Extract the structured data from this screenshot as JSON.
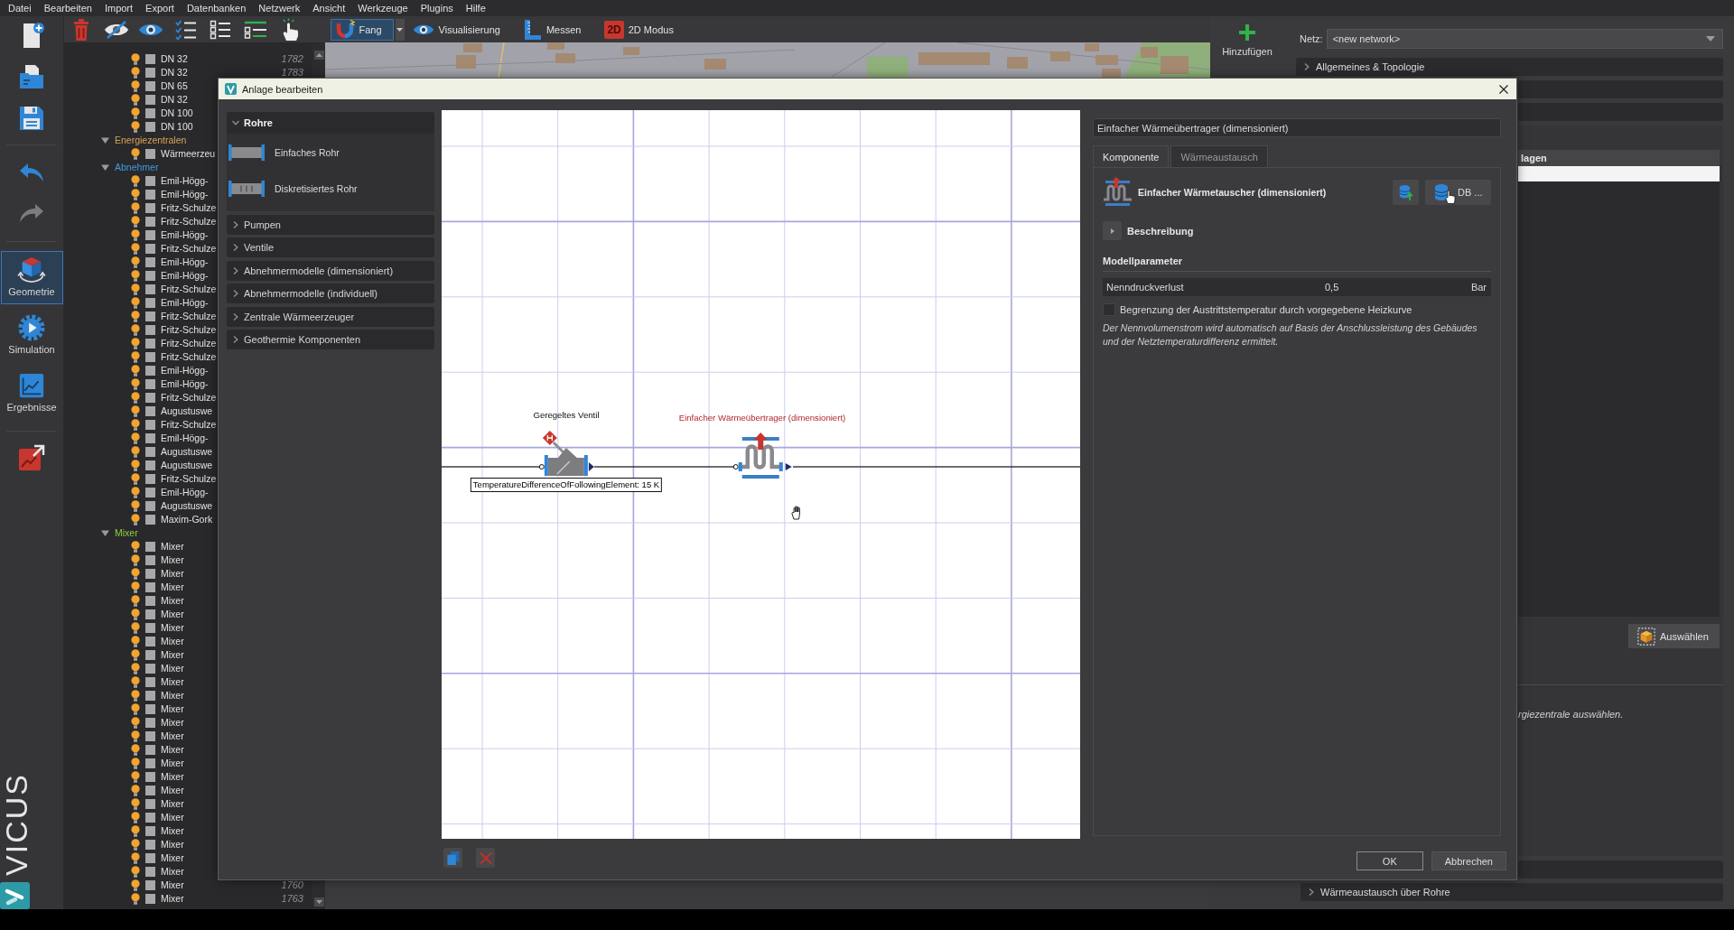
{
  "menu_bar": {
    "items": [
      "Datei",
      "Bearbeiten",
      "Import",
      "Export",
      "Datenbanken",
      "Netzwerk",
      "Ansicht",
      "Werkzeuge",
      "Plugins",
      "Hilfe"
    ]
  },
  "toolbar": {
    "mode_buttons": [
      {
        "kind": "snap",
        "label": "Fang",
        "selected": true,
        "dropdown": true
      },
      {
        "kind": "visualize",
        "label": "Visualisierung",
        "selected": false,
        "dropdown": false
      },
      {
        "kind": "measure",
        "label": "Messen",
        "selected": false,
        "dropdown": false
      },
      {
        "kind": "view2d",
        "badge": "2D",
        "label": "2D Modus",
        "selected": false,
        "dropdown": false
      }
    ]
  },
  "sidebar": {
    "file_actions": [
      {
        "kind": "new",
        "disabled": false
      },
      {
        "kind": "open",
        "disabled": false
      },
      {
        "kind": "save",
        "disabled": false
      }
    ],
    "history_actions": [
      {
        "kind": "undo",
        "disabled": false
      },
      {
        "kind": "redo",
        "disabled": true
      }
    ],
    "nav": [
      {
        "kind": "geometry",
        "label": "Geometrie",
        "selected": true
      },
      {
        "kind": "simulation",
        "label": "Simulation",
        "selected": false
      },
      {
        "kind": "results",
        "label": "Ergebnisse",
        "selected": false
      }
    ],
    "logo_text": "VICUS"
  },
  "tree": {
    "continued_items": [
      {
        "label": "DN 32",
        "number": "1782"
      },
      {
        "label": "DN 32",
        "number": "1783"
      },
      {
        "label": "DN 65"
      },
      {
        "label": "DN 32"
      },
      {
        "label": "DN 100"
      },
      {
        "label": "DN 100"
      }
    ],
    "groups": [
      {
        "label": "Energiezentralen",
        "color": "#d9a25a",
        "expanded": true,
        "children": [
          {
            "label": "Wärmeerzeu"
          }
        ]
      },
      {
        "label": "Abnehmer",
        "color": "#3d9be0",
        "expanded": true,
        "children": [
          {
            "label": "Emil-Högg-"
          },
          {
            "label": "Emil-Högg-"
          },
          {
            "label": "Fritz-Schulze"
          },
          {
            "label": "Fritz-Schulze"
          },
          {
            "label": "Emil-Högg-"
          },
          {
            "label": "Fritz-Schulze"
          },
          {
            "label": "Emil-Högg-"
          },
          {
            "label": "Emil-Högg-"
          },
          {
            "label": "Fritz-Schulze"
          },
          {
            "label": "Emil-Högg-"
          },
          {
            "label": "Fritz-Schulze"
          },
          {
            "label": "Fritz-Schulze"
          },
          {
            "label": "Fritz-Schulze"
          },
          {
            "label": "Fritz-Schulze"
          },
          {
            "label": "Emil-Högg-"
          },
          {
            "label": "Emil-Högg-"
          },
          {
            "label": "Fritz-Schulze"
          },
          {
            "label": "Augustuswe"
          },
          {
            "label": "Fritz-Schulze"
          },
          {
            "label": "Emil-Högg-"
          },
          {
            "label": "Augustuswe"
          },
          {
            "label": "Augustuswe"
          },
          {
            "label": "Fritz-Schulze"
          },
          {
            "label": "Emil-Högg-"
          },
          {
            "label": "Augustuswe"
          },
          {
            "label": "Maxim-Gork"
          }
        ]
      },
      {
        "label": "Mixer",
        "color": "#8fd13a",
        "expanded": true,
        "children": [
          {
            "label": "Mixer"
          },
          {
            "label": "Mixer"
          },
          {
            "label": "Mixer"
          },
          {
            "label": "Mixer"
          },
          {
            "label": "Mixer"
          },
          {
            "label": "Mixer"
          },
          {
            "label": "Mixer"
          },
          {
            "label": "Mixer"
          },
          {
            "label": "Mixer"
          },
          {
            "label": "Mixer"
          },
          {
            "label": "Mixer"
          },
          {
            "label": "Mixer"
          },
          {
            "label": "Mixer"
          },
          {
            "label": "Mixer"
          },
          {
            "label": "Mixer"
          },
          {
            "label": "Mixer"
          },
          {
            "label": "Mixer"
          },
          {
            "label": "Mixer"
          },
          {
            "label": "Mixer"
          },
          {
            "label": "Mixer"
          },
          {
            "label": "Mixer"
          },
          {
            "label": "Mixer"
          },
          {
            "label": "Mixer"
          },
          {
            "label": "Mixer"
          },
          {
            "label": "Mixer"
          },
          {
            "label": "Mixer",
            "number": "1760"
          },
          {
            "label": "Mixer",
            "number": "1763"
          }
        ]
      }
    ]
  },
  "dock": {
    "add_button": "Hinzufügen",
    "network_label": "Netz:",
    "network_value": "<new network>",
    "sections": [
      {
        "label": "Allgemeines & Topologie",
        "expanded": false
      }
    ],
    "list_header": "lagen",
    "select_button": "Auswählen",
    "hint": "rgiezentrale auswählen.",
    "bottom_section": {
      "label": "Wärmeaustausch über Rohre",
      "expanded": false
    }
  },
  "dialog": {
    "title": "Anlage bearbeiten",
    "palette": [
      {
        "label": "Rohre",
        "expanded": true,
        "items": [
          {
            "kind": "simple_pipe",
            "label": "Einfaches Rohr"
          },
          {
            "kind": "discretized_pipe",
            "label": "Diskretisiertes Rohr"
          }
        ]
      },
      {
        "label": "Pumpen",
        "expanded": false
      },
      {
        "label": "Ventile",
        "expanded": false
      },
      {
        "label": "Abnehmermodelle (dimensioniert)",
        "expanded": false
      },
      {
        "label": "Abnehmermodelle (individuell)",
        "expanded": false
      },
      {
        "label": "Zentrale Wärmeerzeuger",
        "expanded": false
      },
      {
        "label": "Geothermie Komponenten",
        "expanded": false
      }
    ],
    "canvas": {
      "nodes": [
        {
          "kind": "valve",
          "label": "Geregeltes Ventil",
          "selected": false,
          "tooltip": "TemperatureDifferenceOfFollowingElement: 15 K"
        },
        {
          "kind": "heat_exchanger",
          "label": "Einfacher Wärmeübertrager (dimensioniert)",
          "selected": true
        }
      ]
    },
    "properties": {
      "header": "Einfacher Wärmeübertrager (dimensioniert)",
      "tabs": [
        {
          "label": "Komponente",
          "selected": true
        },
        {
          "label": "Wärmeaustausch",
          "selected": false
        }
      ],
      "component": {
        "name": "Einfacher Wärmetauscher (dimensioniert)",
        "db_button": "DB ..."
      },
      "description": {
        "label": "Beschreibung",
        "expanded": false
      },
      "section": "Modellparameter",
      "parameters": [
        {
          "label": "Nenndruckverlust",
          "value": "0,5",
          "unit": "Bar"
        }
      ],
      "options": [
        {
          "label": "Begrenzung der Austrittstemperatur durch vorgegebene Heizkurve",
          "checked": false
        }
      ],
      "note": "Der Nennvolumenstrom wird automatisch auf Basis der Anschlussleistung des Gebäudes und der Netztemperaturdifferenz ermittelt."
    },
    "buttons": [
      {
        "kind": "ok",
        "label": "OK"
      },
      {
        "kind": "cancel",
        "label": "Abbrechen"
      }
    ]
  }
}
